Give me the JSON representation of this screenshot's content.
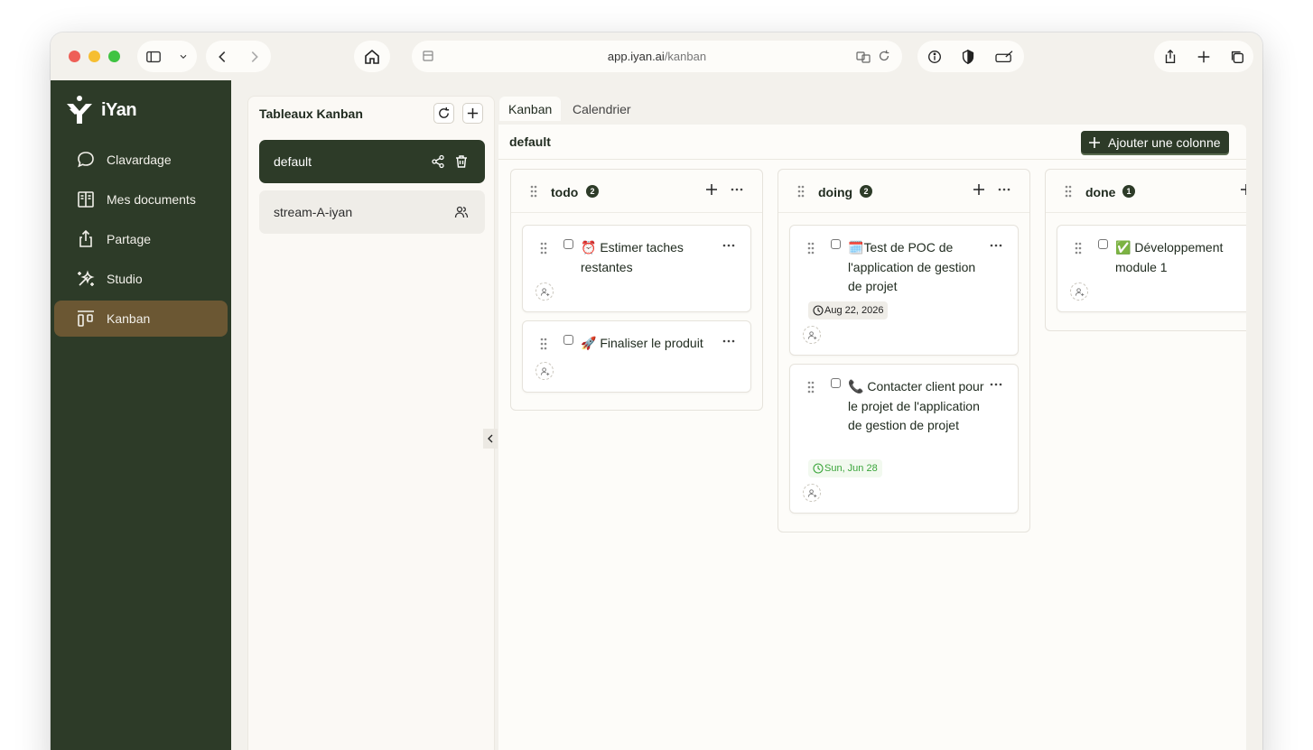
{
  "browser": {
    "url_host": "app.iyan.ai",
    "url_path": "/kanban"
  },
  "sidebar": {
    "logo": "iYan",
    "items": [
      {
        "label": "Clavardage",
        "icon": "chat-bubble-icon"
      },
      {
        "label": "Mes documents",
        "icon": "book-icon"
      },
      {
        "label": "Partage",
        "icon": "share-icon"
      },
      {
        "label": "Studio",
        "icon": "magic-wand-icon"
      },
      {
        "label": "Kanban",
        "icon": "kanban-icon",
        "active": true
      }
    ]
  },
  "boards_panel": {
    "title": "Tableaux Kanban",
    "boards": [
      {
        "name": "default",
        "active": true
      },
      {
        "name": "stream-A-iyan",
        "active": false
      }
    ]
  },
  "tabs": [
    {
      "label": "Kanban",
      "active": true
    },
    {
      "label": "Calendrier",
      "active": false
    }
  ],
  "board": {
    "title": "default",
    "add_column_label": "Ajouter une colonne",
    "columns": [
      {
        "title": "todo",
        "count": "2",
        "cards": [
          {
            "emoji": "⏰",
            "text": "Estimer taches restantes"
          },
          {
            "emoji": "🚀",
            "text": "Finaliser le produit"
          }
        ]
      },
      {
        "title": "doing",
        "count": "2",
        "cards": [
          {
            "emoji": "🗓️",
            "text": "Test de POC de l'application de gestion de projet",
            "date": "Aug 22, 2026"
          },
          {
            "emoji": "📞",
            "text": "Contacter client pour le projet de l'application de gestion de projet",
            "date": "Sun, Jun 28"
          }
        ]
      },
      {
        "title": "done",
        "count": "1",
        "cards": [
          {
            "emoji": "✅",
            "text": "Développement module 1"
          }
        ]
      }
    ]
  },
  "colors": {
    "sidebar_bg": "#2d3b28",
    "active_nav": "#6b5733",
    "due_date_green": "#3aa53a"
  }
}
